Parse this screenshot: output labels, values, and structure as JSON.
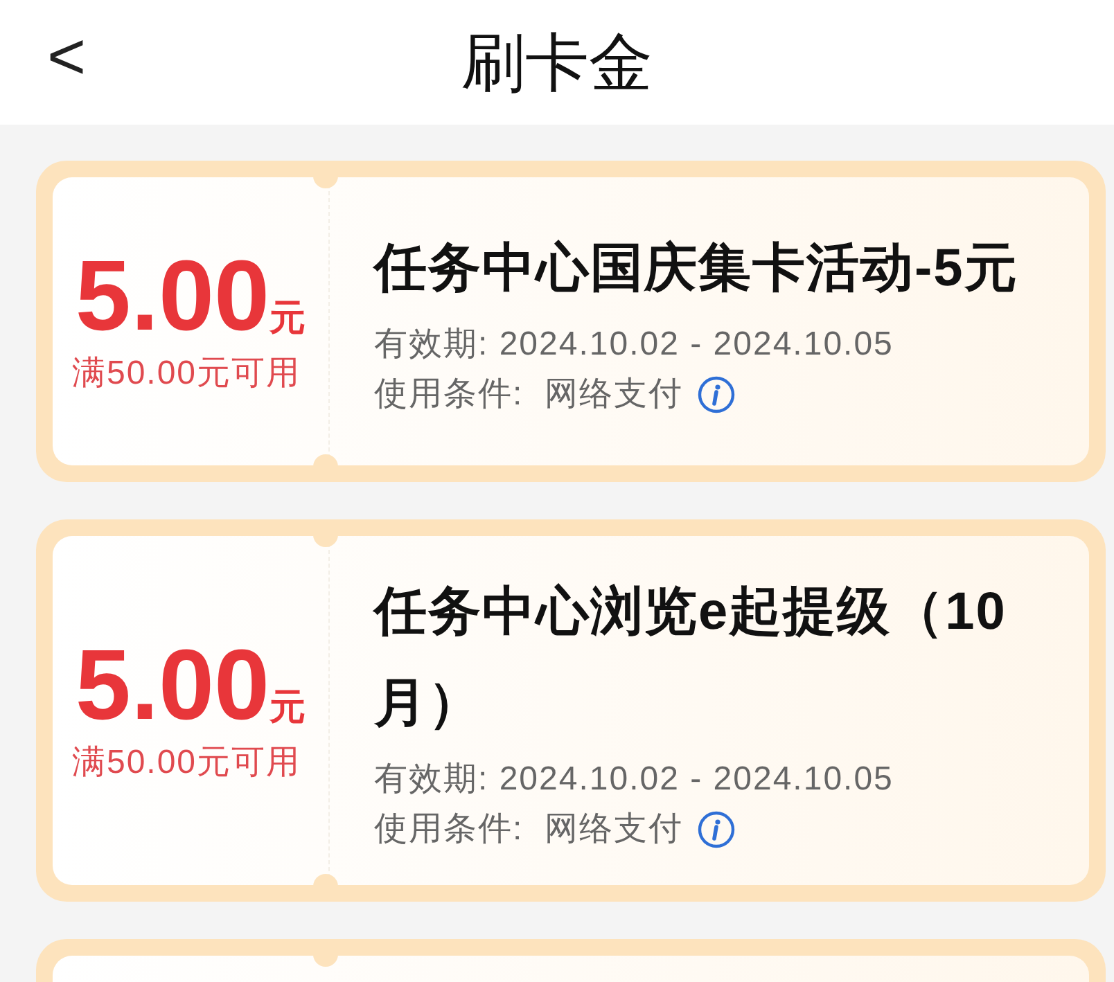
{
  "header": {
    "back_icon": "<",
    "title": "刷卡金"
  },
  "coupons": [
    {
      "amount": "5.00",
      "unit": "元",
      "threshold": "满50.00元可用",
      "name": "任务中心国庆集卡活动-5元",
      "validity": "有效期: 2024.10.02 - 2024.10.05",
      "condition": "使用条件:  网络支付"
    },
    {
      "amount": "5.00",
      "unit": "元",
      "threshold": "满50.00元可用",
      "name": "任务中心浏览e起提级（10月）",
      "validity": "有效期: 2024.10.02 - 2024.10.05",
      "condition": "使用条件:  网络支付"
    }
  ]
}
